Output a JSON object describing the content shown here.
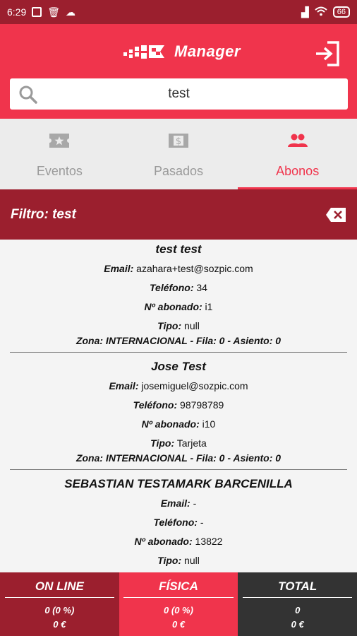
{
  "status_bar": {
    "time": "6:29",
    "battery": "66"
  },
  "colors": {
    "accent": "#f0344c",
    "dark_accent": "#9b1f2e",
    "total_bg": "#333333"
  },
  "header": {
    "title": "Manager",
    "logo_icon": "checkered-flag-icon",
    "logout_icon": "logout-icon"
  },
  "search": {
    "value": "test",
    "icon": "search-icon"
  },
  "tabs": [
    {
      "label": "Eventos",
      "icon": "ticket-star-icon",
      "active": false
    },
    {
      "label": "Pasados",
      "icon": "dollar-ticket-icon",
      "active": false
    },
    {
      "label": "Abonos",
      "icon": "people-icon",
      "active": true
    }
  ],
  "filter": {
    "label": "Filtro: test",
    "clear_icon": "backspace-clear-icon"
  },
  "labels": {
    "email": "Email:",
    "telefono": "Teléfono:",
    "abonado": "Nº abonado:",
    "tipo": "Tipo:"
  },
  "subscribers": [
    {
      "name": "test test",
      "email": "azahara+test@sozpic.com",
      "telefono": "34",
      "abonado": "i1",
      "tipo": "null",
      "zona": "Zona: INTERNACIONAL - Fila: 0 - Asiento: 0"
    },
    {
      "name": "Jose Test",
      "email": "josemiguel@sozpic.com",
      "telefono": "98798789",
      "abonado": "i10",
      "tipo": "Tarjeta",
      "zona": "Zona: INTERNACIONAL - Fila: 0 - Asiento: 0"
    },
    {
      "name": "SEBASTIAN TESTAMARK BARCENILLA",
      "email": "-",
      "telefono": "-",
      "abonado": "13822",
      "tipo": "null",
      "zona": ""
    }
  ],
  "footer": {
    "online": {
      "title": "ON LINE",
      "count": "0 (0 %)",
      "amount": "0 €"
    },
    "fisica": {
      "title": "FÍSICA",
      "count": "0 (0 %)",
      "amount": "0 €"
    },
    "total": {
      "title": "TOTAL",
      "count": "0",
      "amount": "0 €"
    }
  }
}
